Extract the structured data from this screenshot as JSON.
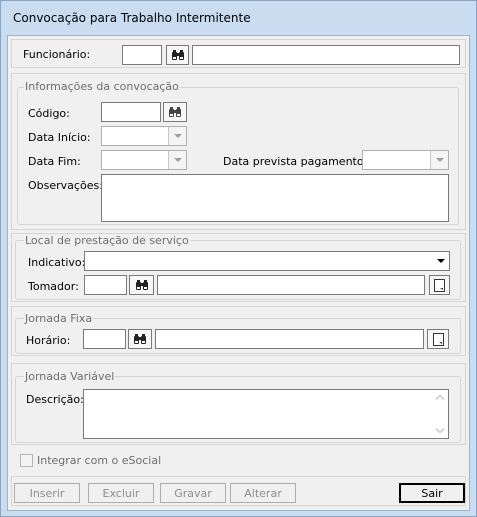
{
  "window": {
    "title": "Convocação para Trabalho Intermitente"
  },
  "funcionario": {
    "label": "Funcionário:",
    "code": "",
    "name": ""
  },
  "convocacao": {
    "legend": "Informações da convocação",
    "codigo_label": "Código:",
    "data_inicio_label": "Data Início:",
    "data_fim_label": "Data Fim:",
    "data_pagamento_label": "Data prevista  pagamento:",
    "observacoes_label": "Observações:"
  },
  "local": {
    "legend": "Local de prestação de serviço",
    "indicativo_label": "Indicativo:",
    "tomador_label": "Tomador:"
  },
  "jornada_fixa": {
    "legend": "Jornada Fixa",
    "horario_label": "Horário:"
  },
  "jornada_variavel": {
    "legend": "Jornada Variável",
    "descricao_label": "Descrição:"
  },
  "esocial": {
    "label": "Integrar com o eSocial",
    "checked": false
  },
  "buttons": {
    "inserir": "Inserir",
    "excluir": "Excluir",
    "gravar": "Gravar",
    "alterar": "Alterar",
    "sair": "Sair"
  },
  "icons": {
    "search": "binoculars-icon",
    "lookup": "document-icon",
    "dropdown": "chevron-down-icon"
  }
}
